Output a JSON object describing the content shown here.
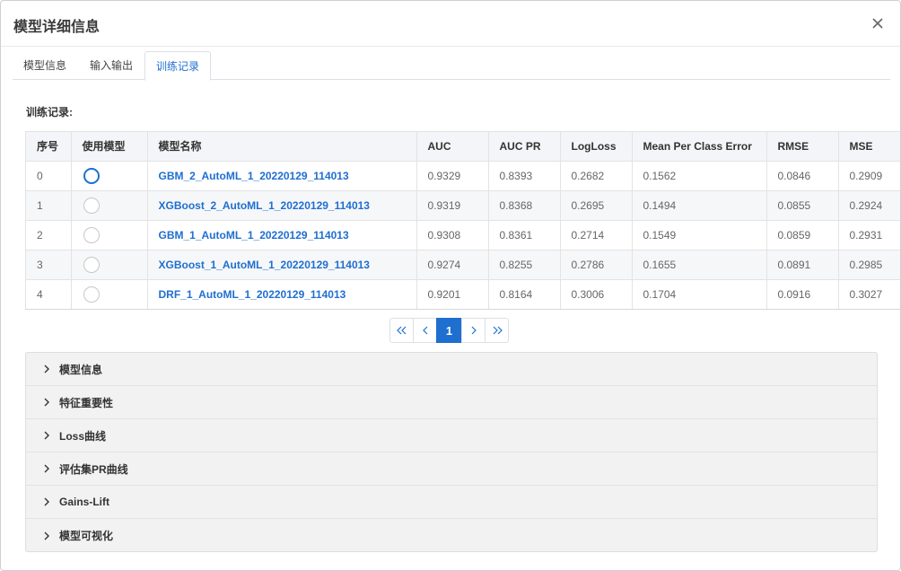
{
  "dialog": {
    "title": "模型详细信息"
  },
  "tabs": [
    {
      "label": "模型信息"
    },
    {
      "label": "输入输出"
    },
    {
      "label": "训练记录"
    }
  ],
  "training": {
    "label": "训练记录:",
    "columns": [
      "序号",
      "使用模型",
      "模型名称",
      "AUC",
      "AUC PR",
      "LogLoss",
      "Mean Per Class Error",
      "RMSE",
      "MSE"
    ],
    "rows": [
      {
        "idx": "0",
        "selected": true,
        "name": "GBM_2_AutoML_1_20220129_114013",
        "auc": "0.9329",
        "aucpr": "0.8393",
        "logloss": "0.2682",
        "mpce": "0.1562",
        "rmse": "0.0846",
        "mse": "0.2909"
      },
      {
        "idx": "1",
        "selected": false,
        "name": "XGBoost_2_AutoML_1_20220129_114013",
        "auc": "0.9319",
        "aucpr": "0.8368",
        "logloss": "0.2695",
        "mpce": "0.1494",
        "rmse": "0.0855",
        "mse": "0.2924"
      },
      {
        "idx": "2",
        "selected": false,
        "name": "GBM_1_AutoML_1_20220129_114013",
        "auc": "0.9308",
        "aucpr": "0.8361",
        "logloss": "0.2714",
        "mpce": "0.1549",
        "rmse": "0.0859",
        "mse": "0.2931"
      },
      {
        "idx": "3",
        "selected": false,
        "name": "XGBoost_1_AutoML_1_20220129_114013",
        "auc": "0.9274",
        "aucpr": "0.8255",
        "logloss": "0.2786",
        "mpce": "0.1655",
        "rmse": "0.0891",
        "mse": "0.2985"
      },
      {
        "idx": "4",
        "selected": false,
        "name": "DRF_1_AutoML_1_20220129_114013",
        "auc": "0.9201",
        "aucpr": "0.8164",
        "logloss": "0.3006",
        "mpce": "0.1704",
        "rmse": "0.0916",
        "mse": "0.3027"
      }
    ]
  },
  "pagination": {
    "current": "1"
  },
  "panels": [
    {
      "label": "模型信息"
    },
    {
      "label": "特征重要性"
    },
    {
      "label": "Loss曲线"
    },
    {
      "label": "评估集PR曲线"
    },
    {
      "label": "Gains-Lift"
    },
    {
      "label": "模型可视化"
    }
  ],
  "colors": {
    "accent": "#1f6fd0"
  }
}
